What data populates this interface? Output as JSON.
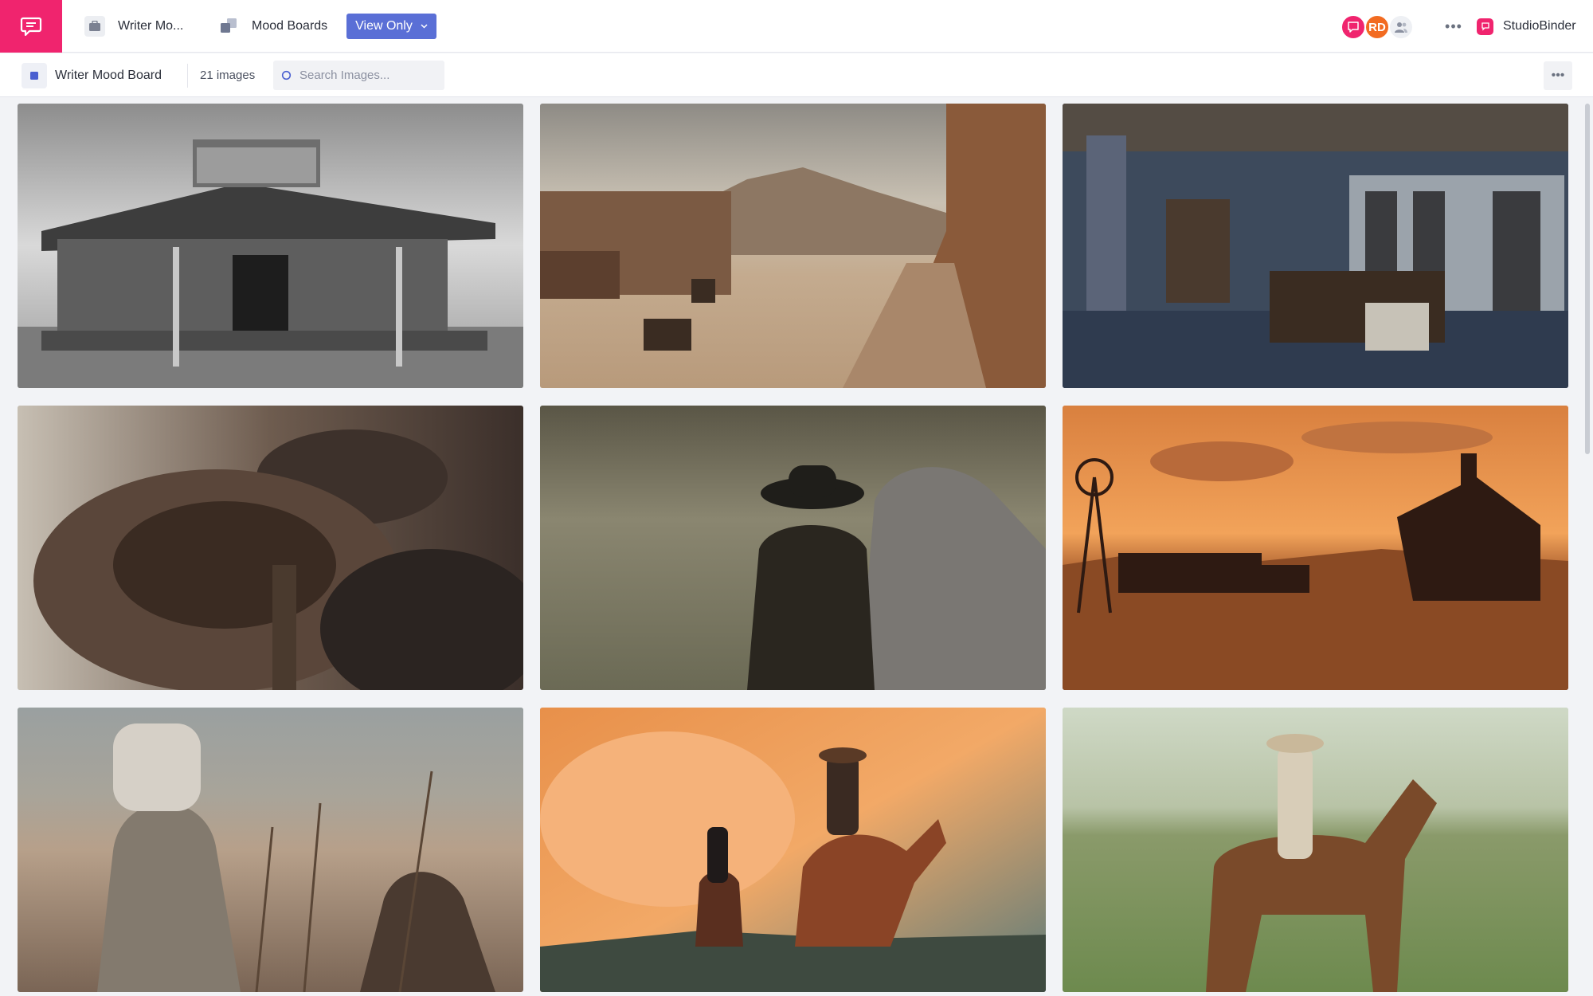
{
  "topbar": {
    "project_label": "Writer Mo...",
    "section_label": "Mood Boards",
    "view_button_label": "View Only",
    "avatar_initials": "RD",
    "brand_name": "StudioBinder"
  },
  "subbar": {
    "board_title": "Writer Mood Board",
    "image_count": "21 images",
    "search_placeholder": "Search Images..."
  },
  "colors": {
    "brand_pink": "#f0246e",
    "accent_blue": "#5a6fd6",
    "avatar_orange": "#f26b21"
  },
  "images": [
    "Old western saloon building (black & white)",
    "Western frontier town main street",
    "Old sheriff office interior",
    "Leather saddle and cowboy hat close-up",
    "Cowboy standing beside grey horse",
    "Windmill and church at orange sunset",
    "Woman in field of dry thistles",
    "Two riders on horseback at sunset",
    "Vintage cowboy with horse on prairie"
  ]
}
